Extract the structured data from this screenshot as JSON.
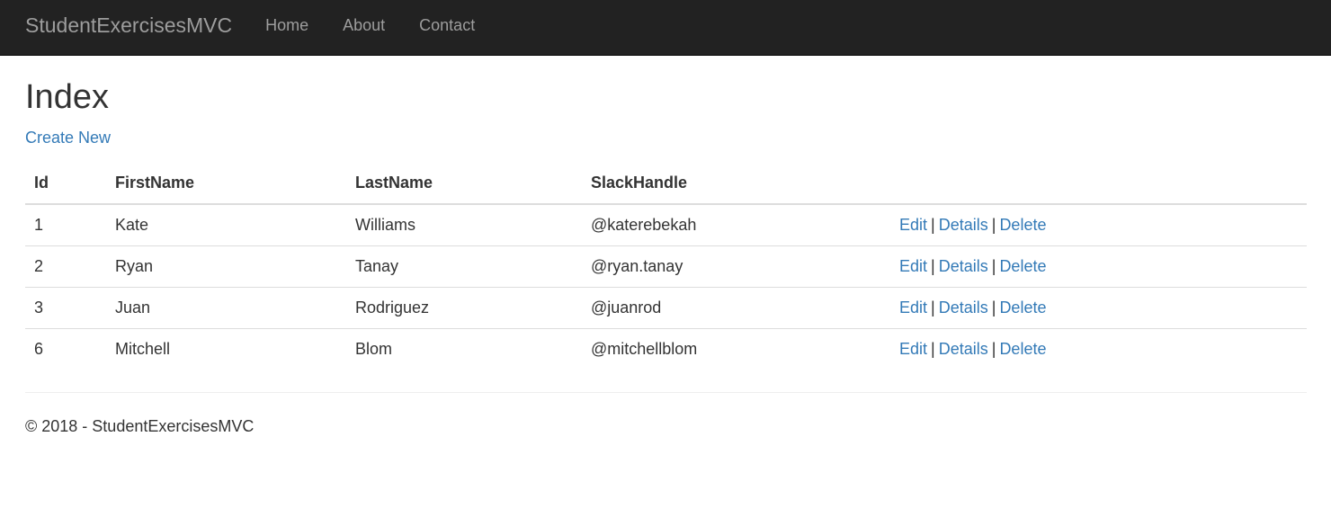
{
  "navbar": {
    "brand": "StudentExercisesMVC",
    "links": [
      "Home",
      "About",
      "Contact"
    ]
  },
  "main": {
    "title": "Index",
    "create_link": "Create New",
    "table": {
      "headers": [
        "Id",
        "FirstName",
        "LastName",
        "SlackHandle",
        ""
      ],
      "rows": [
        {
          "id": "1",
          "first": "Kate",
          "last": "Williams",
          "slack": "@katerebekah"
        },
        {
          "id": "2",
          "first": "Ryan",
          "last": "Tanay",
          "slack": "@ryan.tanay"
        },
        {
          "id": "3",
          "first": "Juan",
          "last": "Rodriguez",
          "slack": "@juanrod"
        },
        {
          "id": "6",
          "first": "Mitchell",
          "last": "Blom",
          "slack": "@mitchellblom"
        }
      ],
      "actions": {
        "edit": "Edit",
        "details": "Details",
        "delete": "Delete",
        "separator": "|"
      }
    }
  },
  "footer": {
    "text": "© 2018 - StudentExercisesMVC"
  },
  "colors": {
    "navbar_bg": "#222222",
    "nav_text": "#9d9d9d",
    "link": "#337ab7",
    "text": "#333333"
  }
}
